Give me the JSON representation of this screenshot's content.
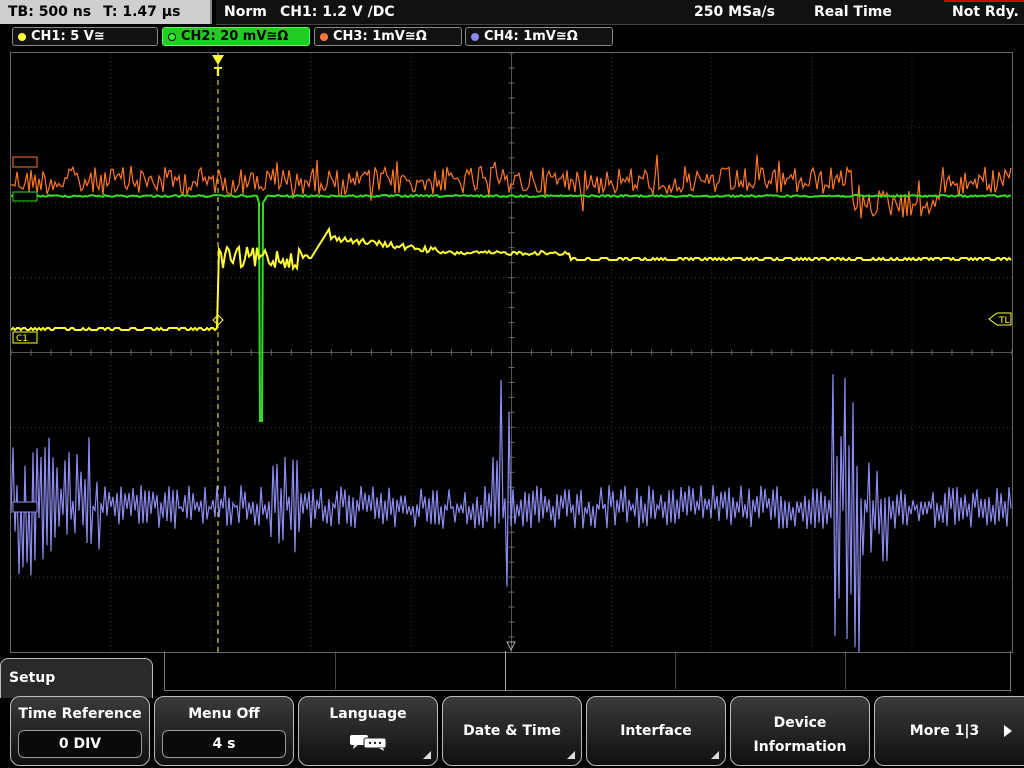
{
  "top": {
    "timebase": "TB: 500 ns",
    "trigger_time": "T: 1.47 µs",
    "mode": "Norm",
    "trigger_info": "CH1: 1.2 V ∕DC",
    "sample_rate": "250 MSa/s",
    "acq_mode": "Real Time",
    "state": "Not Rdy."
  },
  "channels": [
    {
      "label": "CH1: 5 V≅",
      "color": "#ffff33"
    },
    {
      "label": "CH2: 20 mV≅Ω",
      "color": "#33ff33"
    },
    {
      "label": "CH3: 1mV≅Ω",
      "color": "#ff7733"
    },
    {
      "label": "CH4: 1mV≅Ω",
      "color": "#8888ee"
    }
  ],
  "markers": {
    "trigger_level": "TL",
    "ch1": "C1",
    "trigger_pos": "T"
  },
  "colors": {
    "ch1": "#ffff33",
    "ch2": "#33dd22",
    "ch3": "#ff7722",
    "ch4": "#8c8cf0",
    "grid": "#3a3a3a"
  },
  "menu": {
    "title": "Setup",
    "softkeys": [
      {
        "label": "Time Reference",
        "value": "0 DIV"
      },
      {
        "label": "Menu Off",
        "value": "4 s"
      },
      {
        "label": "Language",
        "icon": "speech-bubbles-icon"
      },
      {
        "label": "Date & Time"
      },
      {
        "label": "Interface"
      },
      {
        "label_line1": "Device",
        "label_line2": "Information"
      },
      {
        "label": "More 1|3"
      }
    ]
  }
}
